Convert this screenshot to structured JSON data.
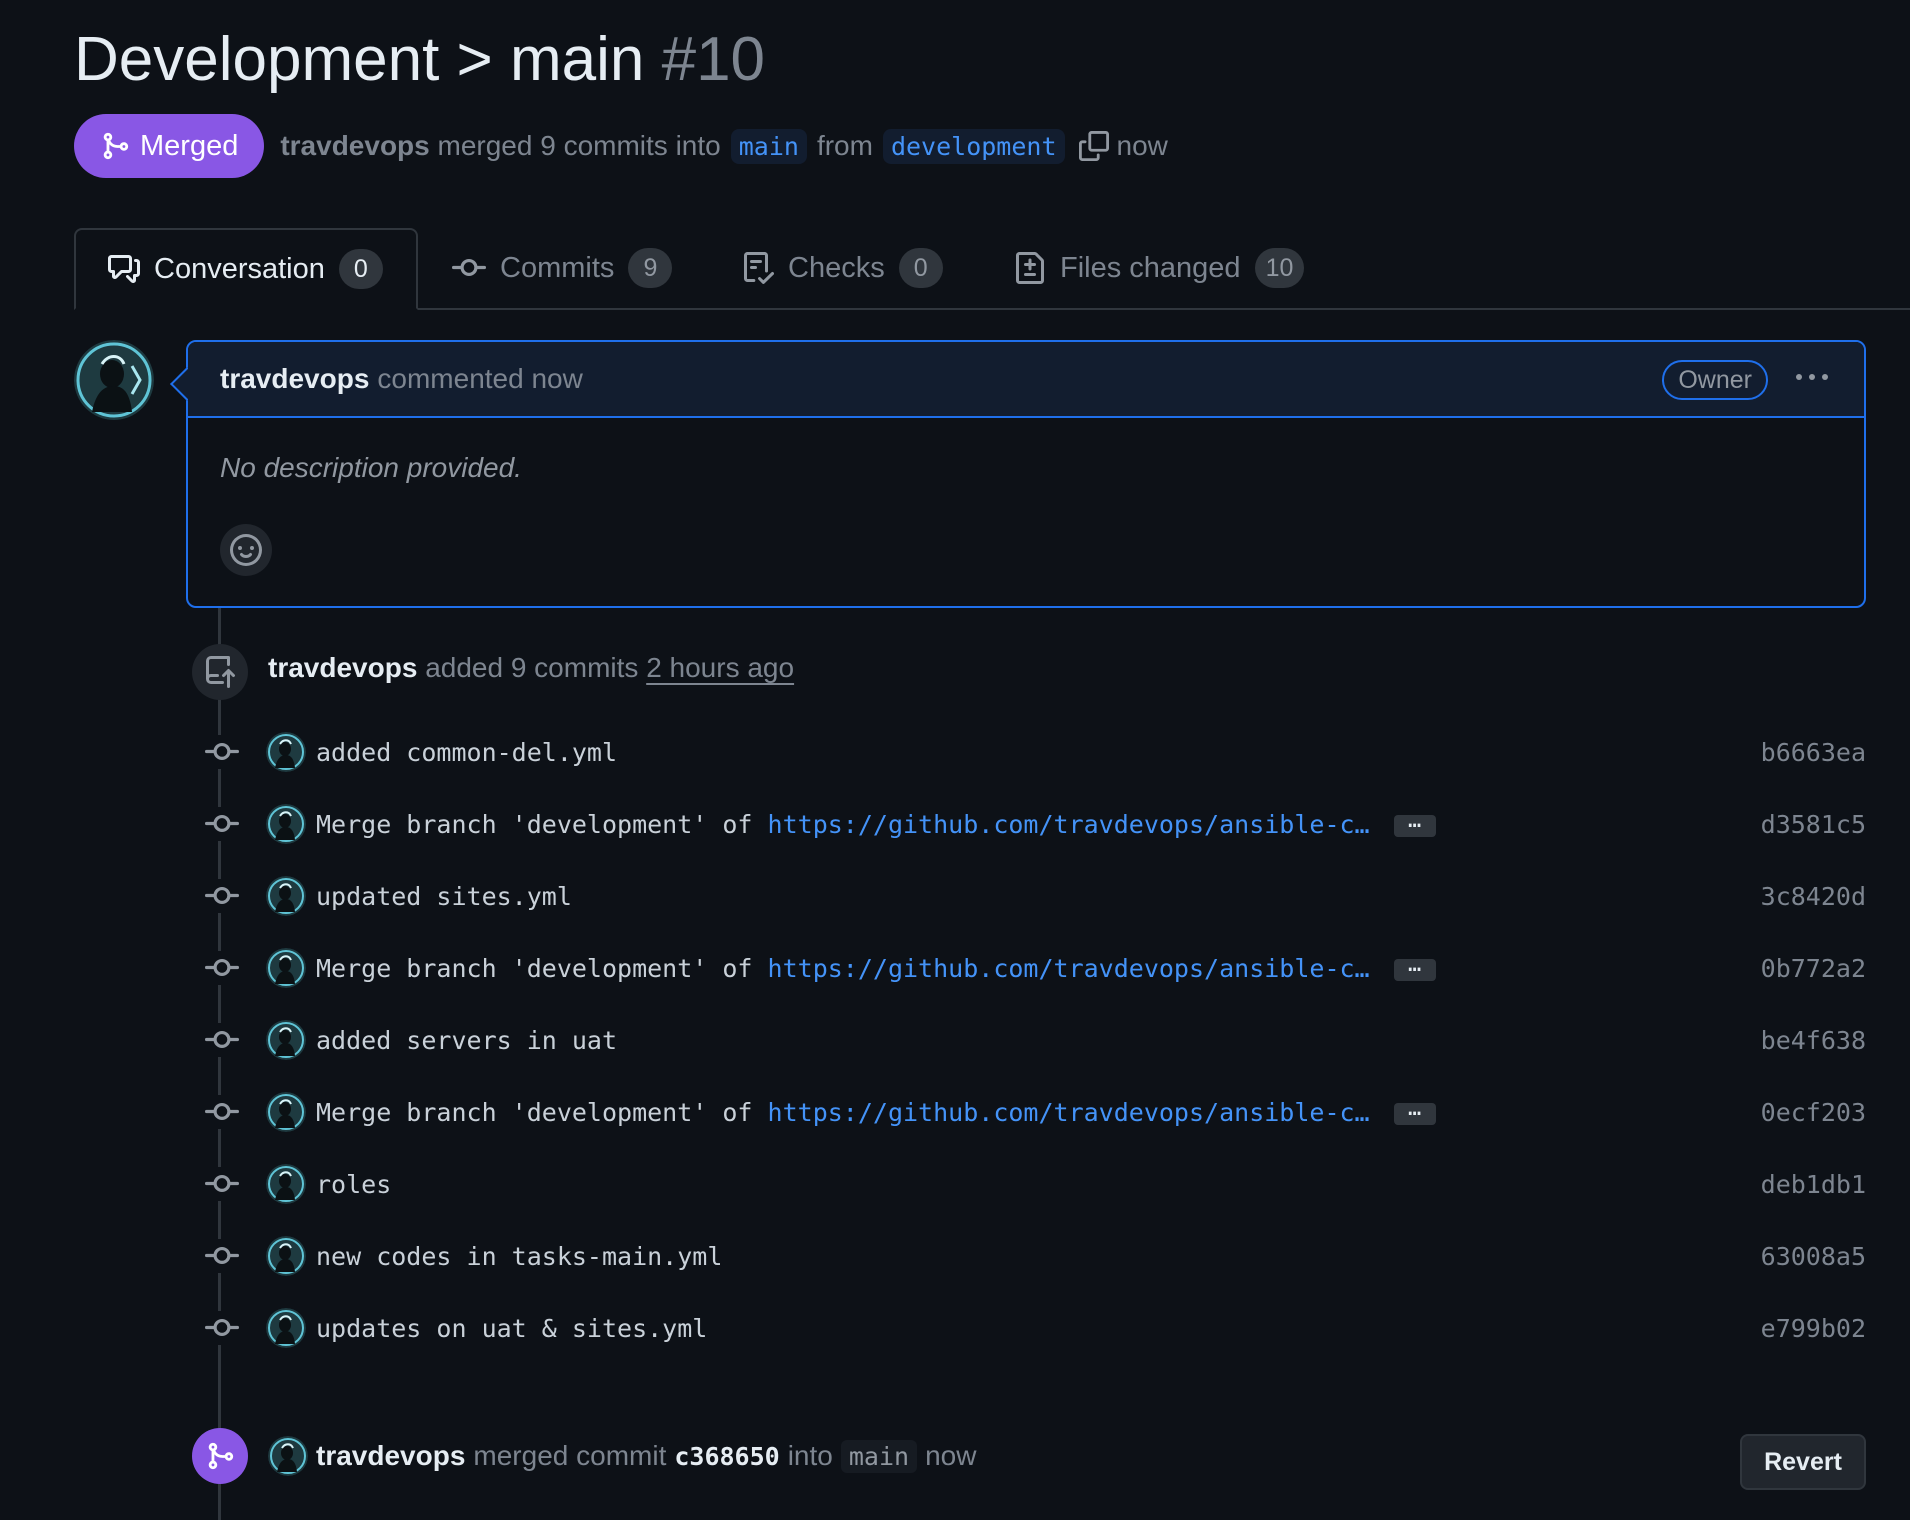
{
  "pr": {
    "title": "Development > main",
    "number": "#10",
    "state_label": "Merged",
    "merger": "travdevops",
    "merged_text": "merged 9 commits into",
    "base_branch": "main",
    "from_text": "from",
    "head_branch": "development",
    "time": "now"
  },
  "tabs": [
    {
      "label": "Conversation",
      "count": "0"
    },
    {
      "label": "Commits",
      "count": "9"
    },
    {
      "label": "Checks",
      "count": "0"
    },
    {
      "label": "Files changed",
      "count": "10"
    }
  ],
  "comment": {
    "author": "travdevops",
    "action": "commented now",
    "role_badge": "Owner",
    "body": "No description provided."
  },
  "push_event": {
    "author": "travdevops",
    "action": "added 9 commits",
    "time": "2 hours ago"
  },
  "commits": [
    {
      "message": "added common-del.yml",
      "link": "",
      "sha": "b6663ea"
    },
    {
      "message": "Merge branch 'development' of ",
      "link": "https://github.com/travdevops/ansible-c…",
      "sha": "d3581c5"
    },
    {
      "message": "updated sites.yml",
      "link": "",
      "sha": "3c8420d"
    },
    {
      "message": "Merge branch 'development' of ",
      "link": "https://github.com/travdevops/ansible-c…",
      "sha": "0b772a2"
    },
    {
      "message": "added servers in uat",
      "link": "",
      "sha": "be4f638"
    },
    {
      "message": "Merge branch 'development' of ",
      "link": "https://github.com/travdevops/ansible-c…",
      "sha": "0ecf203"
    },
    {
      "message": "roles",
      "link": "",
      "sha": "deb1db1"
    },
    {
      "message": "new codes in tasks-main.yml",
      "link": "",
      "sha": "63008a5"
    },
    {
      "message": "updates on uat & sites.yml",
      "link": "",
      "sha": "e799b02"
    }
  ],
  "merge_event": {
    "author": "travdevops",
    "action": "merged commit",
    "sha": "c368650",
    "into_text": "into",
    "branch": "main",
    "time": "now",
    "revert_label": "Revert"
  },
  "ellipsis_label": "…",
  "colors": {
    "background": "#0d1117",
    "merged_purple": "#8957e5",
    "accent_blue": "#1f6feb",
    "link_blue": "#4493f8",
    "muted": "#7d8590"
  }
}
